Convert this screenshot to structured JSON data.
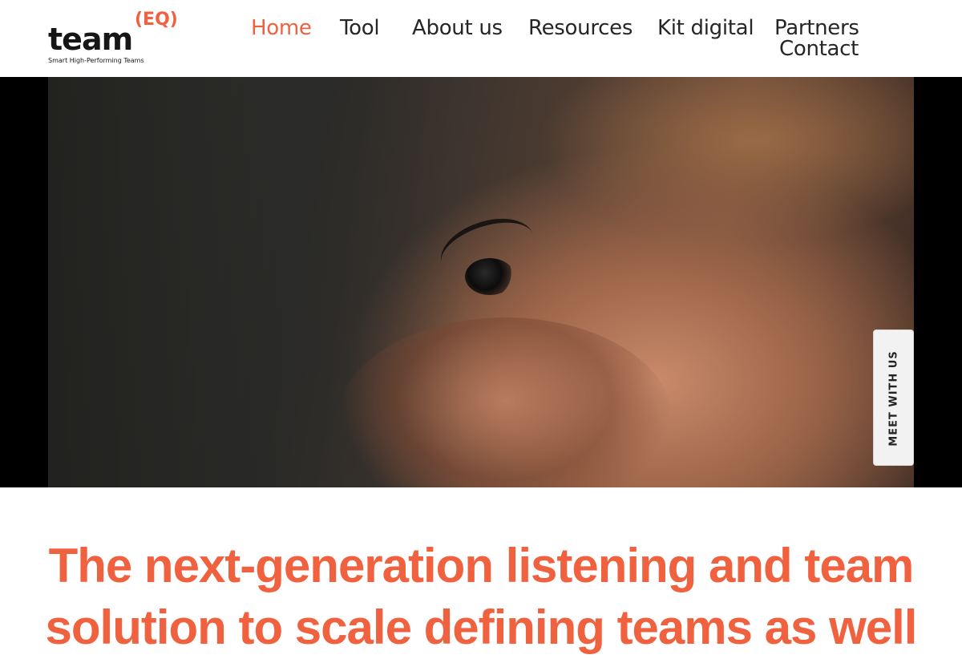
{
  "logo": {
    "word": "team",
    "superscript": "(EQ)",
    "tagline": "Smart High-Performing Teams"
  },
  "nav": {
    "items": [
      {
        "label": "Home",
        "active": true
      },
      {
        "label": "Tool"
      },
      {
        "label": "About us"
      },
      {
        "label": "Resources"
      },
      {
        "label": "Kit digital"
      },
      {
        "label": "Partners"
      },
      {
        "label": "Contact"
      }
    ]
  },
  "hero": {
    "meet_button": "MEET WITH US"
  },
  "headline": {
    "line1": "The next-generation listening and team",
    "line2": "solution to scale defining teams as well"
  },
  "colors": {
    "accent": "#f0623f",
    "text": "#262626",
    "background": "#ffffff"
  }
}
